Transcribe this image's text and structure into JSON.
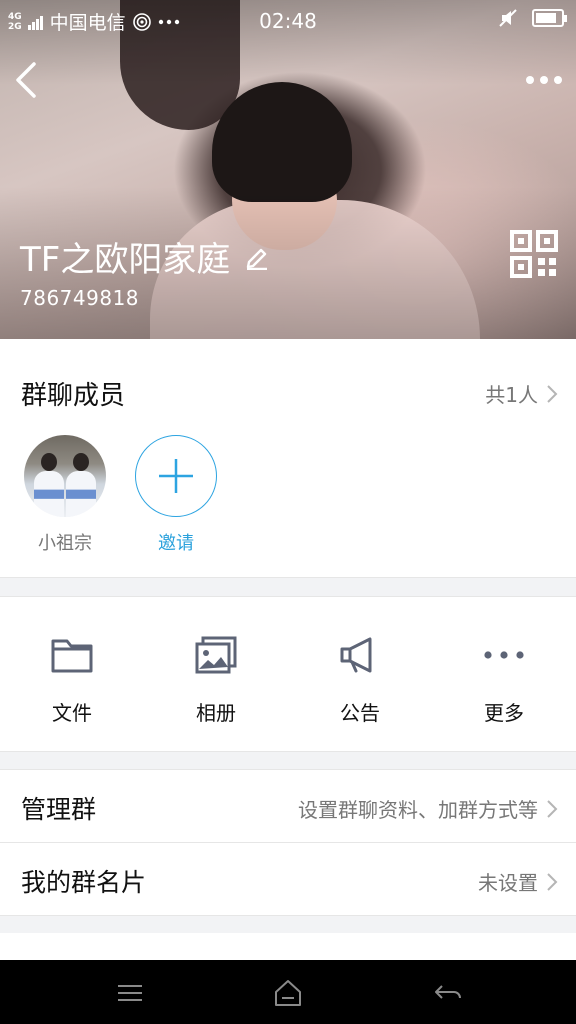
{
  "status_bar": {
    "network_top": "4G",
    "network_sub": "2G",
    "carrier": "中国电信",
    "time": "02:48"
  },
  "header": {
    "group_name": "TF之欧阳家庭",
    "group_id": "786749818"
  },
  "members": {
    "title": "群聊成员",
    "count_label": "共1人",
    "list": [
      {
        "name": "小祖宗"
      }
    ],
    "invite_label": "邀请"
  },
  "tools": [
    {
      "label": "文件",
      "icon": "folder-icon"
    },
    {
      "label": "相册",
      "icon": "album-icon"
    },
    {
      "label": "公告",
      "icon": "megaphone-icon"
    },
    {
      "label": "更多",
      "icon": "more-dots-icon"
    }
  ],
  "rows": [
    {
      "title": "管理群",
      "value": "设置群聊资料、加群方式等"
    },
    {
      "title": "我的群名片",
      "value": "未设置"
    }
  ],
  "colors": {
    "accent": "#2aa1dc",
    "icon_gray": "#5d6476",
    "secondary_text": "#777777"
  }
}
